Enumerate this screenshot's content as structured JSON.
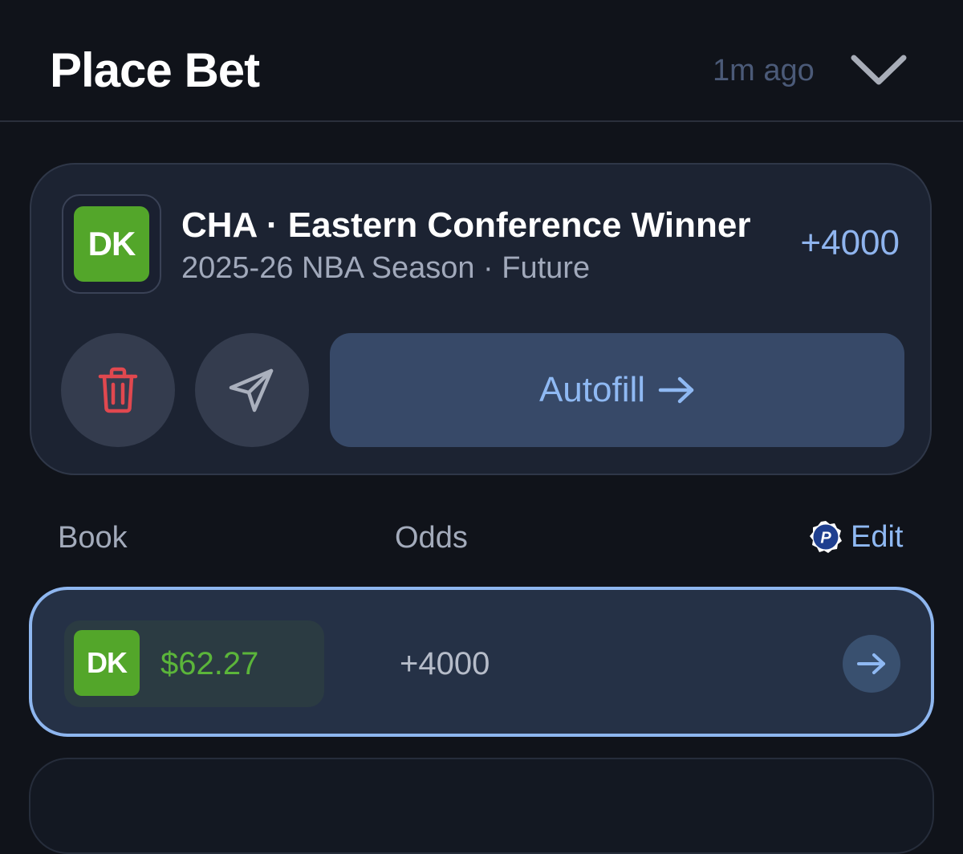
{
  "header": {
    "title": "Place Bet",
    "time_ago": "1m ago",
    "collapse_icon": "chevron-down-icon"
  },
  "bet": {
    "book_logo_text": "DK",
    "title": "CHA · Eastern Conference Winner",
    "subtitle": "2025-26 NBA Season · Future",
    "odds": "+4000",
    "actions": {
      "delete_icon": "trash-icon",
      "share_icon": "send-icon",
      "autofill_label": "Autofill",
      "autofill_icon": "arrow-right-icon"
    }
  },
  "columns": {
    "book": "Book",
    "odds": "Odds",
    "edit_label": "Edit",
    "edit_badge_text": "P"
  },
  "books": [
    {
      "logo_text": "DK",
      "balance": "$62.27",
      "odds": "+4000",
      "selected": true
    }
  ],
  "colors": {
    "background": "#10131a",
    "card": "#1c2332",
    "accent_blue": "#8fb9f3",
    "dk_green": "#53a62a",
    "balance_green": "#5bb53a",
    "delete_red": "#e0484f"
  }
}
